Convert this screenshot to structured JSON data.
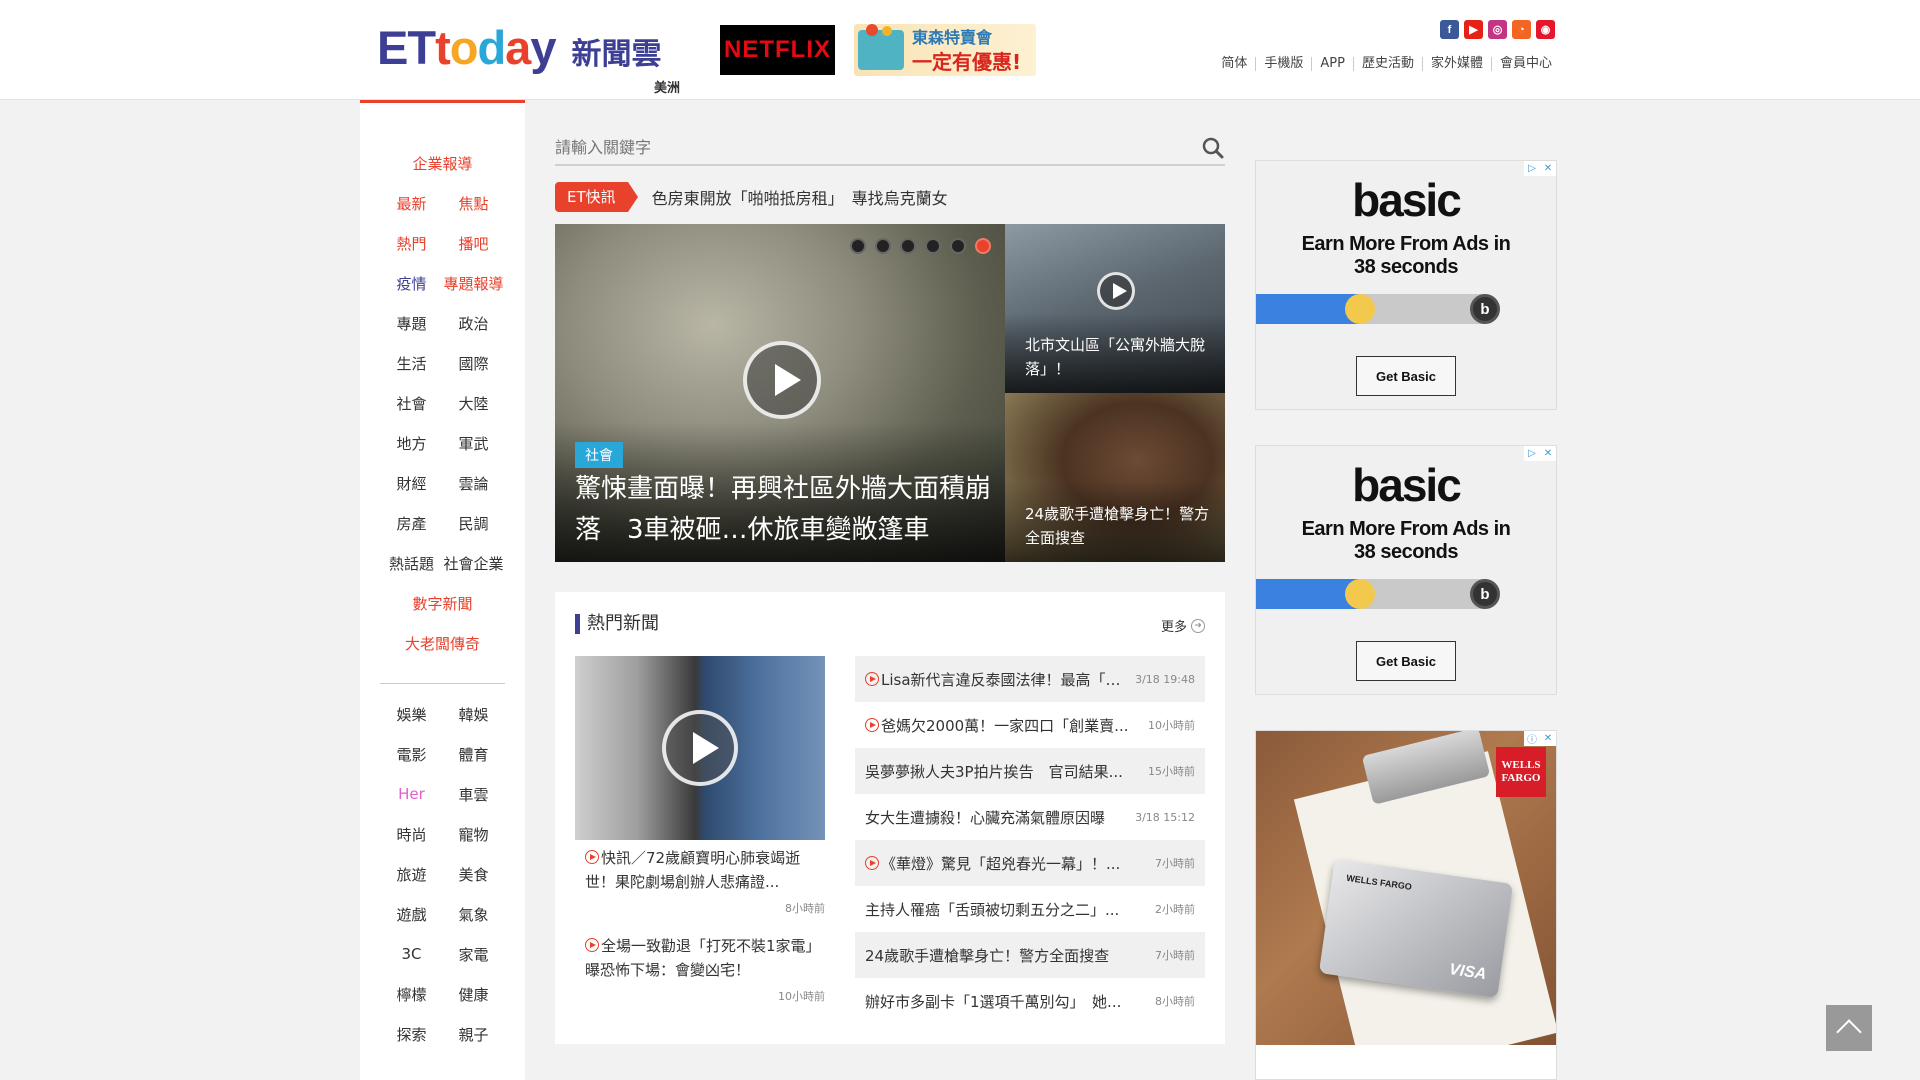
{
  "header": {
    "logo_en": [
      "E",
      "T",
      "t",
      "o",
      "d",
      "a",
      "y"
    ],
    "logo_zh": "新聞雲",
    "region": "美洲",
    "netflix": "NETFLIX",
    "tomato_line1": "東森特賣會",
    "tomato_line2": "一定有優惠!",
    "social": [
      {
        "icon": "facebook-icon",
        "glyph": "f",
        "color": "#3b5998"
      },
      {
        "icon": "youtube-icon",
        "glyph": "▶",
        "color": "#e62117"
      },
      {
        "icon": "instagram-icon",
        "glyph": "◎",
        "color": "#c13584"
      },
      {
        "icon": "rss-icon",
        "glyph": "◔",
        "color": "#f26522"
      },
      {
        "icon": "weibo-icon",
        "glyph": "◉",
        "color": "#e6162d"
      }
    ],
    "links": [
      "简体",
      "手機版",
      "APP",
      "歷史活動",
      "家外媒體",
      "會員中心"
    ]
  },
  "nav": {
    "rows1": [
      {
        "cells": [
          "企業報導"
        ],
        "cls": [
          "orange"
        ]
      },
      {
        "cells": [
          "最新",
          "焦點"
        ],
        "cls": [
          "orange",
          "orange"
        ]
      },
      {
        "cells": [
          "熱門",
          "播吧"
        ],
        "cls": [
          "orange",
          "orange"
        ]
      },
      {
        "cells": [
          "疫情",
          "專題報導"
        ],
        "cls": [
          "blue",
          "orange"
        ]
      },
      {
        "cells": [
          "專題",
          "政治"
        ],
        "cls": [
          "",
          ""
        ]
      },
      {
        "cells": [
          "生活",
          "國際"
        ],
        "cls": [
          "",
          ""
        ]
      },
      {
        "cells": [
          "社會",
          "大陸"
        ],
        "cls": [
          "",
          ""
        ]
      },
      {
        "cells": [
          "地方",
          "軍武"
        ],
        "cls": [
          "",
          ""
        ]
      },
      {
        "cells": [
          "財經",
          "雲論"
        ],
        "cls": [
          "",
          ""
        ]
      },
      {
        "cells": [
          "房產",
          "民調"
        ],
        "cls": [
          "",
          ""
        ]
      },
      {
        "cells": [
          "熱話題",
          "社會企業"
        ],
        "cls": [
          "",
          ""
        ]
      },
      {
        "cells": [
          "數字新聞"
        ],
        "cls": [
          "orange"
        ]
      },
      {
        "cells": [
          "大老闆傳奇"
        ],
        "cls": [
          "orange"
        ]
      }
    ],
    "rows2": [
      {
        "cells": [
          "娛樂",
          "韓娛"
        ],
        "cls": [
          "",
          ""
        ]
      },
      {
        "cells": [
          "電影",
          "體育"
        ],
        "cls": [
          "",
          ""
        ]
      },
      {
        "cells": [
          "Her",
          "車雲"
        ],
        "cls": [
          "pink",
          ""
        ]
      },
      {
        "cells": [
          "時尚",
          "寵物"
        ],
        "cls": [
          "",
          ""
        ]
      },
      {
        "cells": [
          "旅遊",
          "美食"
        ],
        "cls": [
          "",
          ""
        ]
      },
      {
        "cells": [
          "遊戲",
          "氣象"
        ],
        "cls": [
          "",
          ""
        ]
      },
      {
        "cells": [
          "3C",
          "家電"
        ],
        "cls": [
          "",
          ""
        ]
      },
      {
        "cells": [
          "檸檬",
          "健康"
        ],
        "cls": [
          "",
          ""
        ]
      },
      {
        "cells": [
          "探索",
          "親子"
        ],
        "cls": [
          "",
          ""
        ]
      }
    ]
  },
  "search": {
    "placeholder": "請輸入關鍵字"
  },
  "flash": {
    "tag": "ET快訊",
    "text": "色房東開放「啪啪抵房租」　專找烏克蘭女"
  },
  "hero": {
    "main": {
      "category": "社會",
      "title": "驚悚畫面曝！再興社區外牆大面積崩落　3車被砸…休旅車變敞篷車"
    },
    "side1": "北市文山區「公寓外牆大脫落」！",
    "side2": "24歲歌手遭槍擊身亡！警方全面搜查"
  },
  "hot": {
    "title": "熱門新聞",
    "more": "更多",
    "left": [
      {
        "title": "快訊／72歲顧寶明心肺衰竭逝世！果陀劇場創辦人悲痛證...",
        "time": "8小時前",
        "video": true
      },
      {
        "title": "全場一致勸退「打死不裝1家電」　曝恐怖下場：會變凶宅！",
        "time": "10小時前",
        "video": true
      }
    ],
    "list": [
      {
        "title": "Lisa新代言違反泰國法律！最高「罰...",
        "time": "3/18 19:48",
        "video": true
      },
      {
        "title": "爸媽欠2000萬！一家四口「創業賣...",
        "time": "10小時前",
        "video": true
      },
      {
        "title": "吳夢夢揪人夫3P拍片挨告　官司結果...",
        "time": "15小時前",
        "video": false
      },
      {
        "title": "女大生遭擄殺！心臟充滿氣體原因曝",
        "time": "3/18 15:12",
        "video": false
      },
      {
        "title": "《華燈》驚見「超兇春光一幕」！...",
        "time": "7小時前",
        "video": true
      },
      {
        "title": "主持人罹癌「舌頭被切剩五分之二」...",
        "time": "2小時前",
        "video": false
      },
      {
        "title": "24歲歌手遭槍擊身亡！警方全面搜查",
        "time": "7小時前",
        "video": false
      },
      {
        "title": "辦好市多副卡「1選項千萬別勾」　她...",
        "time": "8小時前",
        "video": false
      }
    ]
  },
  "ads": {
    "basic": {
      "logo": "basic",
      "tagline1": "Earn More From Ads in",
      "tagline2": "38 seconds",
      "button": "Get Basic",
      "progress": 0.45
    },
    "wells": {
      "brand": "WELLS FARGO",
      "logo_line1": "WELLS",
      "logo_line2": "FARGO",
      "visa": "VISA"
    }
  }
}
